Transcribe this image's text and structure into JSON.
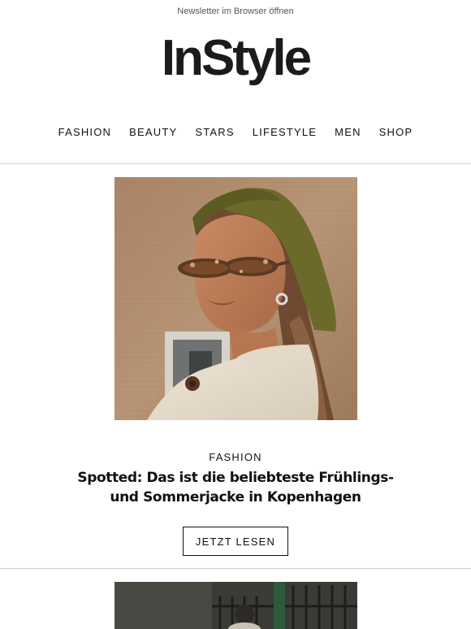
{
  "header": {
    "browser_link": "Newsletter im Browser öffnen",
    "logo_text": "InStyle"
  },
  "nav": {
    "items": [
      {
        "label": "FASHION"
      },
      {
        "label": "BEAUTY"
      },
      {
        "label": "STARS"
      },
      {
        "label": "LIFESTYLE"
      },
      {
        "label": "MEN"
      },
      {
        "label": "SHOP"
      }
    ]
  },
  "article": {
    "category": "FASHION",
    "headline_line1": "Spotted: Das ist die beliebteste Frühlings-",
    "headline_line2": "und Sommerjacke in Kopenhagen",
    "cta_label": "JETZT LESEN"
  },
  "colors": {
    "text": "#111111",
    "divider": "#cfcfcf",
    "headscarf": "#6b6a2a"
  }
}
